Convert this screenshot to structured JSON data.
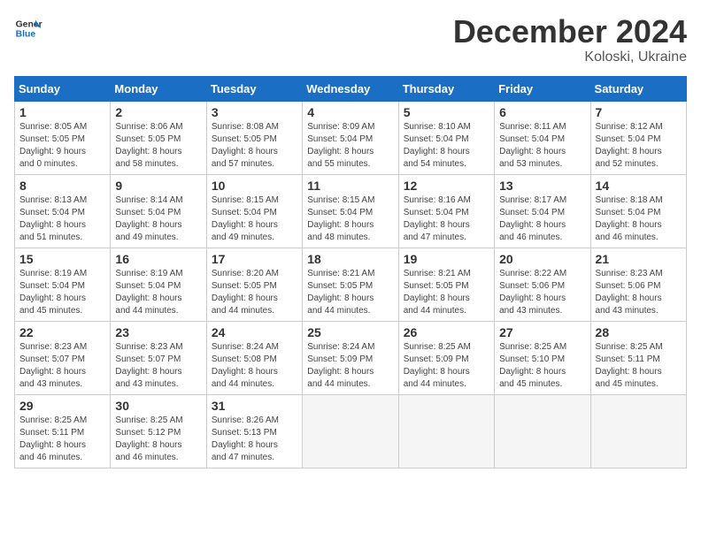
{
  "header": {
    "logo_line1": "General",
    "logo_line2": "Blue",
    "month": "December 2024",
    "location": "Koloski, Ukraine"
  },
  "days_of_week": [
    "Sunday",
    "Monday",
    "Tuesday",
    "Wednesday",
    "Thursday",
    "Friday",
    "Saturday"
  ],
  "weeks": [
    [
      {
        "day": 1,
        "info": "Sunrise: 8:05 AM\nSunset: 5:05 PM\nDaylight: 9 hours\nand 0 minutes."
      },
      {
        "day": 2,
        "info": "Sunrise: 8:06 AM\nSunset: 5:05 PM\nDaylight: 8 hours\nand 58 minutes."
      },
      {
        "day": 3,
        "info": "Sunrise: 8:08 AM\nSunset: 5:05 PM\nDaylight: 8 hours\nand 57 minutes."
      },
      {
        "day": 4,
        "info": "Sunrise: 8:09 AM\nSunset: 5:04 PM\nDaylight: 8 hours\nand 55 minutes."
      },
      {
        "day": 5,
        "info": "Sunrise: 8:10 AM\nSunset: 5:04 PM\nDaylight: 8 hours\nand 54 minutes."
      },
      {
        "day": 6,
        "info": "Sunrise: 8:11 AM\nSunset: 5:04 PM\nDaylight: 8 hours\nand 53 minutes."
      },
      {
        "day": 7,
        "info": "Sunrise: 8:12 AM\nSunset: 5:04 PM\nDaylight: 8 hours\nand 52 minutes."
      }
    ],
    [
      {
        "day": 8,
        "info": "Sunrise: 8:13 AM\nSunset: 5:04 PM\nDaylight: 8 hours\nand 51 minutes."
      },
      {
        "day": 9,
        "info": "Sunrise: 8:14 AM\nSunset: 5:04 PM\nDaylight: 8 hours\nand 49 minutes."
      },
      {
        "day": 10,
        "info": "Sunrise: 8:15 AM\nSunset: 5:04 PM\nDaylight: 8 hours\nand 49 minutes."
      },
      {
        "day": 11,
        "info": "Sunrise: 8:15 AM\nSunset: 5:04 PM\nDaylight: 8 hours\nand 48 minutes."
      },
      {
        "day": 12,
        "info": "Sunrise: 8:16 AM\nSunset: 5:04 PM\nDaylight: 8 hours\nand 47 minutes."
      },
      {
        "day": 13,
        "info": "Sunrise: 8:17 AM\nSunset: 5:04 PM\nDaylight: 8 hours\nand 46 minutes."
      },
      {
        "day": 14,
        "info": "Sunrise: 8:18 AM\nSunset: 5:04 PM\nDaylight: 8 hours\nand 46 minutes."
      }
    ],
    [
      {
        "day": 15,
        "info": "Sunrise: 8:19 AM\nSunset: 5:04 PM\nDaylight: 8 hours\nand 45 minutes."
      },
      {
        "day": 16,
        "info": "Sunrise: 8:19 AM\nSunset: 5:04 PM\nDaylight: 8 hours\nand 44 minutes."
      },
      {
        "day": 17,
        "info": "Sunrise: 8:20 AM\nSunset: 5:05 PM\nDaylight: 8 hours\nand 44 minutes."
      },
      {
        "day": 18,
        "info": "Sunrise: 8:21 AM\nSunset: 5:05 PM\nDaylight: 8 hours\nand 44 minutes."
      },
      {
        "day": 19,
        "info": "Sunrise: 8:21 AM\nSunset: 5:05 PM\nDaylight: 8 hours\nand 44 minutes."
      },
      {
        "day": 20,
        "info": "Sunrise: 8:22 AM\nSunset: 5:06 PM\nDaylight: 8 hours\nand 43 minutes."
      },
      {
        "day": 21,
        "info": "Sunrise: 8:23 AM\nSunset: 5:06 PM\nDaylight: 8 hours\nand 43 minutes."
      }
    ],
    [
      {
        "day": 22,
        "info": "Sunrise: 8:23 AM\nSunset: 5:07 PM\nDaylight: 8 hours\nand 43 minutes."
      },
      {
        "day": 23,
        "info": "Sunrise: 8:23 AM\nSunset: 5:07 PM\nDaylight: 8 hours\nand 43 minutes."
      },
      {
        "day": 24,
        "info": "Sunrise: 8:24 AM\nSunset: 5:08 PM\nDaylight: 8 hours\nand 44 minutes."
      },
      {
        "day": 25,
        "info": "Sunrise: 8:24 AM\nSunset: 5:09 PM\nDaylight: 8 hours\nand 44 minutes."
      },
      {
        "day": 26,
        "info": "Sunrise: 8:25 AM\nSunset: 5:09 PM\nDaylight: 8 hours\nand 44 minutes."
      },
      {
        "day": 27,
        "info": "Sunrise: 8:25 AM\nSunset: 5:10 PM\nDaylight: 8 hours\nand 45 minutes."
      },
      {
        "day": 28,
        "info": "Sunrise: 8:25 AM\nSunset: 5:11 PM\nDaylight: 8 hours\nand 45 minutes."
      }
    ],
    [
      {
        "day": 29,
        "info": "Sunrise: 8:25 AM\nSunset: 5:11 PM\nDaylight: 8 hours\nand 46 minutes."
      },
      {
        "day": 30,
        "info": "Sunrise: 8:25 AM\nSunset: 5:12 PM\nDaylight: 8 hours\nand 46 minutes."
      },
      {
        "day": 31,
        "info": "Sunrise: 8:26 AM\nSunset: 5:13 PM\nDaylight: 8 hours\nand 47 minutes."
      },
      null,
      null,
      null,
      null
    ]
  ]
}
